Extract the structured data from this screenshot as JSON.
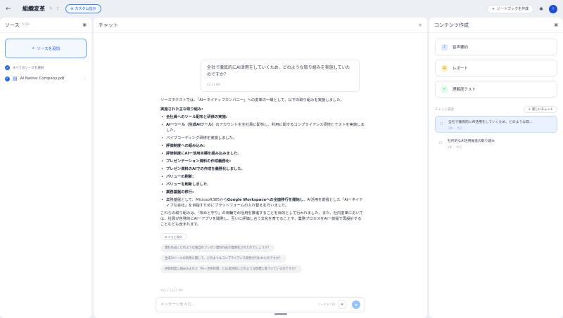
{
  "header": {
    "back_icon": "arrow-left-icon",
    "title": "組織変革",
    "custom_label": "カスタム指示",
    "notebook_label": "ノートブックを作成",
    "avatar_initial": "I"
  },
  "sources": {
    "title": "ソース",
    "subtitle": "1/10",
    "add_label": "ソースを追加",
    "select_all": "すべてのソースを選択",
    "files": [
      {
        "name": "AI Native Company.pdf"
      }
    ]
  },
  "chat": {
    "title": "チャット",
    "user_message": "全社で徹底的にAI活用をしていくため、どのような取り組みを実施していたのですか？",
    "user_time": "12:11 PM",
    "answer": {
      "intro": "ソースネクストでは、「AIーネイティブカンパニー」への変革の一環として、以下の取り組みを実施しました。",
      "heading": "実施された主な取り組み:",
      "items": [
        {
          "bold": "全社員へのツール配布と研修の実施:",
          "text": ""
        },
        {
          "bold": "AIーツール（生成AIツール）",
          "text": "のアカウントを全社員に配布し、利用に関するコンプライアンス研修とテストを実施しました。"
        },
        {
          "bold": "",
          "text": "バイブコーディング研修を実施しました。"
        },
        {
          "bold": "評価制度への組み込み:",
          "text": ""
        },
        {
          "bold": "評価制度にAIー活用目標を組み込みました",
          "text": "。"
        },
        {
          "bold": "プレゼンテーション資料の作成義務化:",
          "text": ""
        },
        {
          "bold": "プレゼン資料のAIでの作成を義務化しました",
          "text": "。"
        },
        {
          "bold": "バリューの刷新:",
          "text": ""
        },
        {
          "bold": "バリューを刷新しました",
          "text": "。"
        },
        {
          "bold": "業務基盤の移行:",
          "text": ""
        },
        {
          "bold": "",
          "text": "業務基盤として、Microsoft365から",
          "bold2": "Google Workspaceへの全面移行を開始し",
          "text2": "、AI活用を前提とした「AIーネイティブな会社」を目指すためにプラットフォームの入れ替えを行いました。"
        }
      ],
      "closing": "これらの取り組みは、「攻めと守り」の両輪でAI活用を推進することを目的として行われました。また、社内変革においては、社員が自発的にAIーアプリを開発し、互いに評価し合う文化を育てることや、業務プロセスをAIー前提で再設計することなども含まれます。",
      "save_note": "メモに保存",
      "suggestions": [
        "資料作成にどのような独自のプレゼン資料作成が義務化されたのでしょうか？",
        "生成AIツールの利用に関して、どのようなコンプライアンス研修が行われたのですか？",
        "評価制度に組み込まれた「AIー活用目標」とは具体的にどのような指標に基づいているのですか？"
      ]
    },
    "footer_note": "今日 • 12:11 PM",
    "composer_placeholder": "メッセージを入力…",
    "source_count": "ソース 1 / 10"
  },
  "studio": {
    "title": "コンテンツ作成",
    "tools": [
      {
        "label": "音声要約",
        "icon": "audio-icon",
        "color": "#dbeafe",
        "fg": "#2563eb"
      },
      {
        "label": "レポート",
        "icon": "report-icon",
        "color": "#fef3c7",
        "fg": "#d97706"
      },
      {
        "label": "理解度テスト",
        "icon": "quiz-icon",
        "color": "#dcfce7",
        "fg": "#16a34a"
      }
    ],
    "history_title": "チャット履歴",
    "new_chat_label": "新しいチャット",
    "history": [
      {
        "title": "全社で徹底的にAI活用をしていくため、どのような取…",
        "meta": "2件 ・ 今日"
      },
      {
        "title": "社内的なAI活用推進の取り組み",
        "meta": "2件 ・ 今日"
      }
    ]
  }
}
